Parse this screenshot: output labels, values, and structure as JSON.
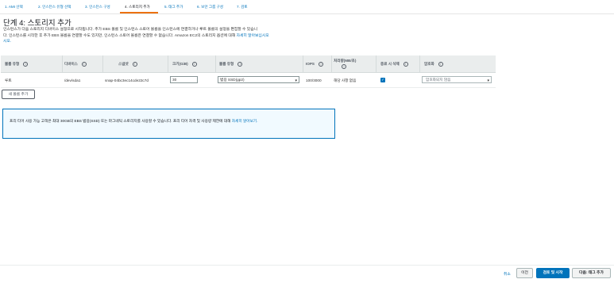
{
  "steps": [
    {
      "label": "1. AMI 선택"
    },
    {
      "label": "2. 인스턴스 유형 선택"
    },
    {
      "label": "3. 인스턴스 구성"
    },
    {
      "label": "4. 스토리지 추가"
    },
    {
      "label": "5. 태그 추가"
    },
    {
      "label": "6. 보안 그룹 구성"
    },
    {
      "label": "7. 검토"
    }
  ],
  "page": {
    "title": "단계 4: 스토리지 추가",
    "desc_line1": "인스턴스가 다음 스토리지 디바이스 설정으로 시작됩니다. 추가 EBS 볼륨 및 인스턴스 스토어 볼륨을 인스턴스에 연결하거나 루트 볼륨의 설정을 편집할 수 있습니",
    "desc_line2": "다. 인스턴스를 시작한 후 추가 EBS 볼륨을 연결할 수도 있지만, 인스턴스 스토어 볼륨은 연결할 수 없습니다. Amazon EC2의 스토리지 옵션에 대해 ",
    "desc_link": "자세히 알아보십시오",
    "desc_link_tail": "시오."
  },
  "table": {
    "headers": {
      "volume_type": "볼륨 유형",
      "device": "디바이스",
      "snapshot": "스냅샷",
      "size": "크기(GiB)",
      "vol_kind": "볼륨 유형",
      "iops": "IOPS",
      "throughput": "처리량(MB/초)",
      "delete_on_term": "종료 시 삭제",
      "encryption": "암호화"
    },
    "row": {
      "volume_type": "루트",
      "device": "/dev/sda1",
      "snapshot": "snap-04bc3ec14cde22c7d",
      "size": "30",
      "vol_kind": "범용 SSD(gp2)",
      "iops": "100/3000",
      "throughput": "해당 사항 없음",
      "delete_on_term": true,
      "encryption": "암호화되지 않음"
    }
  },
  "add_volume_label": "새 볼륨 추가",
  "info": {
    "text": "프리 티어 사용 가능 고객은 최대 30GB의 EBS 범용(SSD) 또는 마그네틱 스토리지를 사용할 수 있습니다. 프리 티어 자격 및 사용량 제한에 대해 ",
    "link": "자세히 알아보기."
  },
  "footer": {
    "cancel": "취소",
    "prev": "이전",
    "review": "검토 및 시작",
    "next": "다음: 태그 추가"
  },
  "colors": {
    "accent": "#0073bb",
    "step_active": "#ec7211"
  }
}
